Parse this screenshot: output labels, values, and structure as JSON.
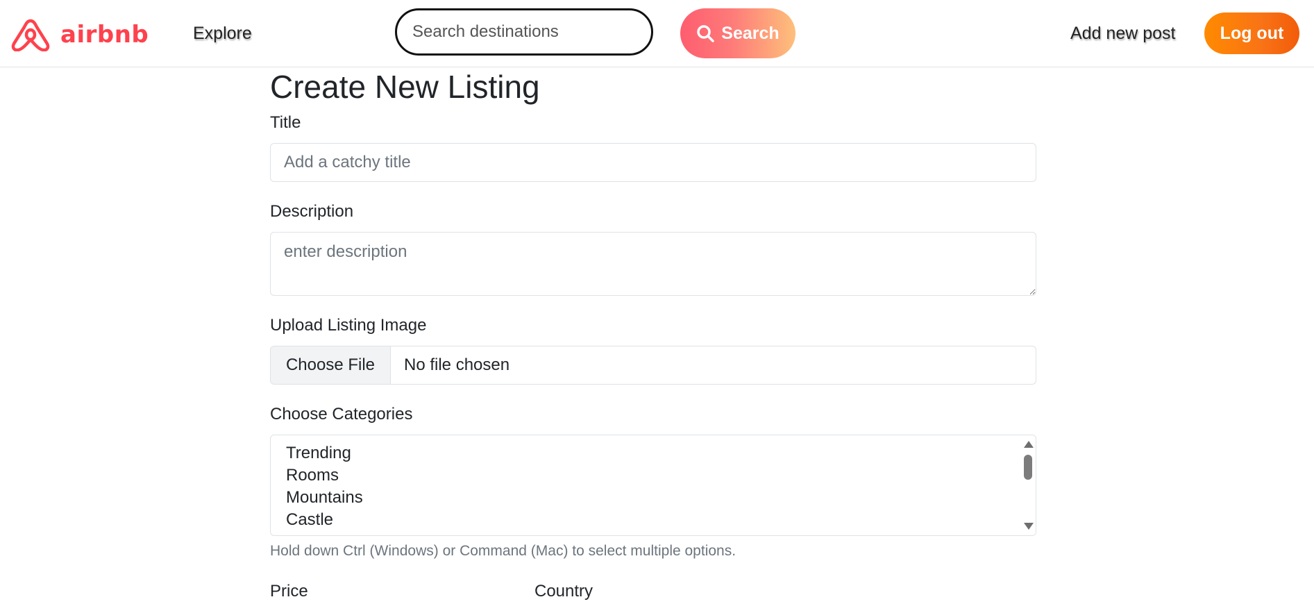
{
  "brand": {
    "name": "airbnb",
    "color": "#fe424d",
    "icon": "airbnb-logo-icon"
  },
  "nav": {
    "explore": "Explore",
    "search_placeholder": "Search destinations",
    "search_button": "Search",
    "search_icon": "search-icon",
    "add_post": "Add new post",
    "logout": "Log out"
  },
  "form": {
    "heading": "Create New Listing",
    "title_label": "Title",
    "title_placeholder": "Add a catchy title",
    "description_label": "Description",
    "description_placeholder": "enter description",
    "image_label": "Upload Listing Image",
    "file_button": "Choose File",
    "file_status": "No file chosen",
    "categories_label": "Choose Categories",
    "categories": [
      "Trending",
      "Rooms",
      "Mountains",
      "Castle"
    ],
    "categories_help": "Hold down Ctrl (Windows) or Command (Mac) to select multiple options.",
    "price_label": "Price",
    "country_label": "Country"
  },
  "colors": {
    "search_gradient": [
      "#fe5d6f",
      "#fdc07b"
    ],
    "logout_gradient": [
      "#ff8a00",
      "#f25c0a"
    ]
  }
}
